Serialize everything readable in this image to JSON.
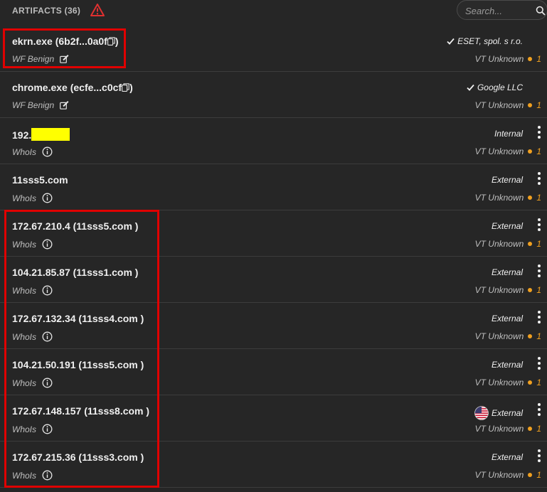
{
  "header": {
    "title": "ARTIFACTS (36)",
    "search_placeholder": "Search..."
  },
  "colors": {
    "background": "#262626",
    "warning": "#e03030",
    "highlight_box": "#e00000",
    "vt_dot": "#f0a020",
    "redaction": "#ffff00"
  },
  "rows": [
    {
      "name": "ekrn.exe (6b2f...0a0f",
      "name_suffix": ")",
      "copy_icon": true,
      "sub": "WF Benign",
      "sub_icon": "edit-icon",
      "tag": "ESET, spol. s r.o.",
      "tag_icon": "check-icon",
      "vt_label": "VT Unknown",
      "vt_count": "1",
      "has_menu": false
    },
    {
      "name": "chrome.exe (ecfe...c0cf",
      "name_suffix": ")",
      "copy_icon": true,
      "sub": "WF Benign",
      "sub_icon": "edit-icon",
      "tag": "Google LLC",
      "tag_icon": "check-icon",
      "vt_label": "VT Unknown",
      "vt_count": "1",
      "has_menu": false
    },
    {
      "name": "192.",
      "redacted": true,
      "sub": "WhoIs",
      "sub_icon": "info-icon",
      "tag": "Internal",
      "vt_label": "VT Unknown",
      "vt_count": "1",
      "has_menu": true
    },
    {
      "name": "11sss5.com",
      "sub": "WhoIs",
      "sub_icon": "info-icon",
      "tag": "External",
      "vt_label": "VT Unknown",
      "vt_count": "1",
      "has_menu": true
    },
    {
      "name": "172.67.210.4 (11sss5.com )",
      "sub": "WhoIs",
      "sub_icon": "info-icon",
      "tag": "External",
      "vt_label": "VT Unknown",
      "vt_count": "1",
      "has_menu": true
    },
    {
      "name": "104.21.85.87 (11sss1.com )",
      "sub": "WhoIs",
      "sub_icon": "info-icon",
      "tag": "External",
      "vt_label": "VT Unknown",
      "vt_count": "1",
      "has_menu": true
    },
    {
      "name": "172.67.132.34 (11sss4.com )",
      "sub": "WhoIs",
      "sub_icon": "info-icon",
      "tag": "External",
      "vt_label": "VT Unknown",
      "vt_count": "1",
      "has_menu": true
    },
    {
      "name": "104.21.50.191 (11sss5.com )",
      "sub": "WhoIs",
      "sub_icon": "info-icon",
      "tag": "External",
      "vt_label": "VT Unknown",
      "vt_count": "1",
      "has_menu": true
    },
    {
      "name": "172.67.148.157 (11sss8.com )",
      "sub": "WhoIs",
      "sub_icon": "info-icon",
      "tag": "External",
      "tag_icon": "us-flag-icon",
      "vt_label": "VT Unknown",
      "vt_count": "1",
      "has_menu": true
    },
    {
      "name": "172.67.215.36 (11sss3.com )",
      "sub": "WhoIs",
      "sub_icon": "info-icon",
      "tag": "External",
      "vt_label": "VT Unknown",
      "vt_count": "1",
      "has_menu": true
    }
  ]
}
